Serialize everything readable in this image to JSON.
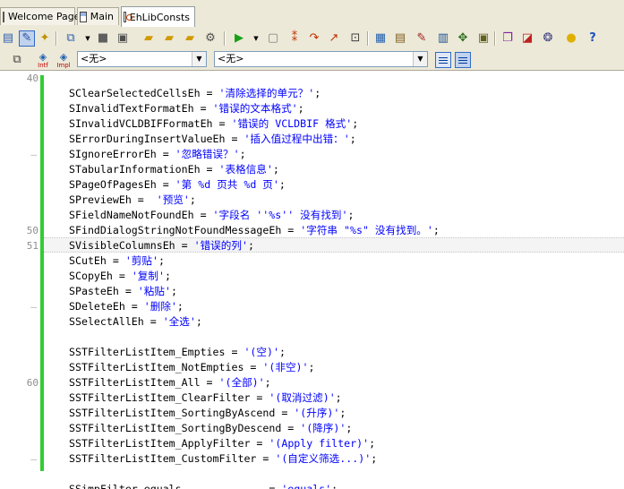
{
  "tabs": [
    {
      "label": "Welcome Page",
      "icon": "document-icon"
    },
    {
      "label": "Main",
      "icon": "form-icon"
    },
    {
      "label": "EhLibConsts",
      "icon": "unit-icon",
      "active": true
    }
  ],
  "toolbar2": {
    "combo1_value": "<无>",
    "combo2_value": "<无>",
    "intf_label": "Intf",
    "impl_label": "Impl"
  },
  "editor": {
    "gutter_numbers": [
      {
        "line": 0,
        "text": "40"
      },
      {
        "line": 10,
        "text": "50"
      },
      {
        "line": 11,
        "text": "51"
      },
      {
        "line": 20,
        "text": "60"
      }
    ],
    "gutter_dashes": [
      5,
      15,
      25
    ],
    "current_line_index": 11,
    "lines": [
      {
        "ident": "",
        "str": "",
        "tail": ""
      },
      {
        "ident": "SClearSelectedCellsEh = ",
        "str": "'清除选择的单元？'",
        "tail": ";"
      },
      {
        "ident": "SInvalidTextFormatEh = ",
        "str": "'错误的文本格式'",
        "tail": ";"
      },
      {
        "ident": "SInvalidVCLDBIFFormatEh = ",
        "str": "'错误的 VCLDBIF 格式'",
        "tail": ";"
      },
      {
        "ident": "SErrorDuringInsertValueEh = ",
        "str": "'插入值过程中出错：'",
        "tail": ";"
      },
      {
        "ident": "SIgnoreErrorEh = ",
        "str": "'忽略错误？'",
        "tail": ";"
      },
      {
        "ident": "STabularInformationEh = ",
        "str": "'表格信息'",
        "tail": ";"
      },
      {
        "ident": "SPageOfPagesEh = ",
        "str": "'第 %d 页共 %d 页'",
        "tail": ";"
      },
      {
        "ident": "SPreviewEh =  ",
        "str": "'预览'",
        "tail": ";"
      },
      {
        "ident": "SFieldNameNotFoundEh = ",
        "str": "'字段名 ''%s'' 没有找到'",
        "tail": ";"
      },
      {
        "ident": "SFindDialogStringNotFoundMessageEh = ",
        "str": "'字符串 \"%s\" 没有找到。'",
        "tail": ";"
      },
      {
        "ident": "SVisibleColumnsEh = ",
        "str": "'错误的列'",
        "tail": ";"
      },
      {
        "ident": "SCutEh = ",
        "str": "'剪贴'",
        "tail": ";"
      },
      {
        "ident": "SCopyEh = ",
        "str": "'复制'",
        "tail": ";"
      },
      {
        "ident": "SPasteEh = ",
        "str": "'粘贴'",
        "tail": ";"
      },
      {
        "ident": "SDeleteEh = ",
        "str": "'删除'",
        "tail": ";"
      },
      {
        "ident": "SSelectAllEh = ",
        "str": "'全选'",
        "tail": ";"
      },
      {
        "ident": "",
        "str": "",
        "tail": ""
      },
      {
        "ident": "SSTFilterListItem_Empties = ",
        "str": "'(空)'",
        "tail": ";"
      },
      {
        "ident": "SSTFilterListItem_NotEmpties = ",
        "str": "'(非空)'",
        "tail": ";"
      },
      {
        "ident": "SSTFilterListItem_All = ",
        "str": "'(全部)'",
        "tail": ";"
      },
      {
        "ident": "SSTFilterListItem_ClearFilter = ",
        "str": "'(取消过滤)'",
        "tail": ";"
      },
      {
        "ident": "SSTFilterListItem_SortingByAscend = ",
        "str": "'(升序)'",
        "tail": ";"
      },
      {
        "ident": "SSTFilterListItem_SortingByDescend = ",
        "str": "'(降序)'",
        "tail": ";"
      },
      {
        "ident": "SSTFilterListItem_ApplyFilter = ",
        "str": "'(Apply filter)'",
        "tail": ";"
      },
      {
        "ident": "SSTFilterListItem_CustomFilter = ",
        "str": "'(自定义筛选...)'",
        "tail": ";"
      },
      {
        "ident": "",
        "str": "",
        "tail": ""
      },
      {
        "ident": "SSimpFilter_equals              = ",
        "str": "'equals'",
        "tail": ";"
      }
    ]
  },
  "colors": {
    "change_bar": "#33cc33",
    "string_literal": "#0000ff",
    "chrome": "#ece9d8"
  }
}
